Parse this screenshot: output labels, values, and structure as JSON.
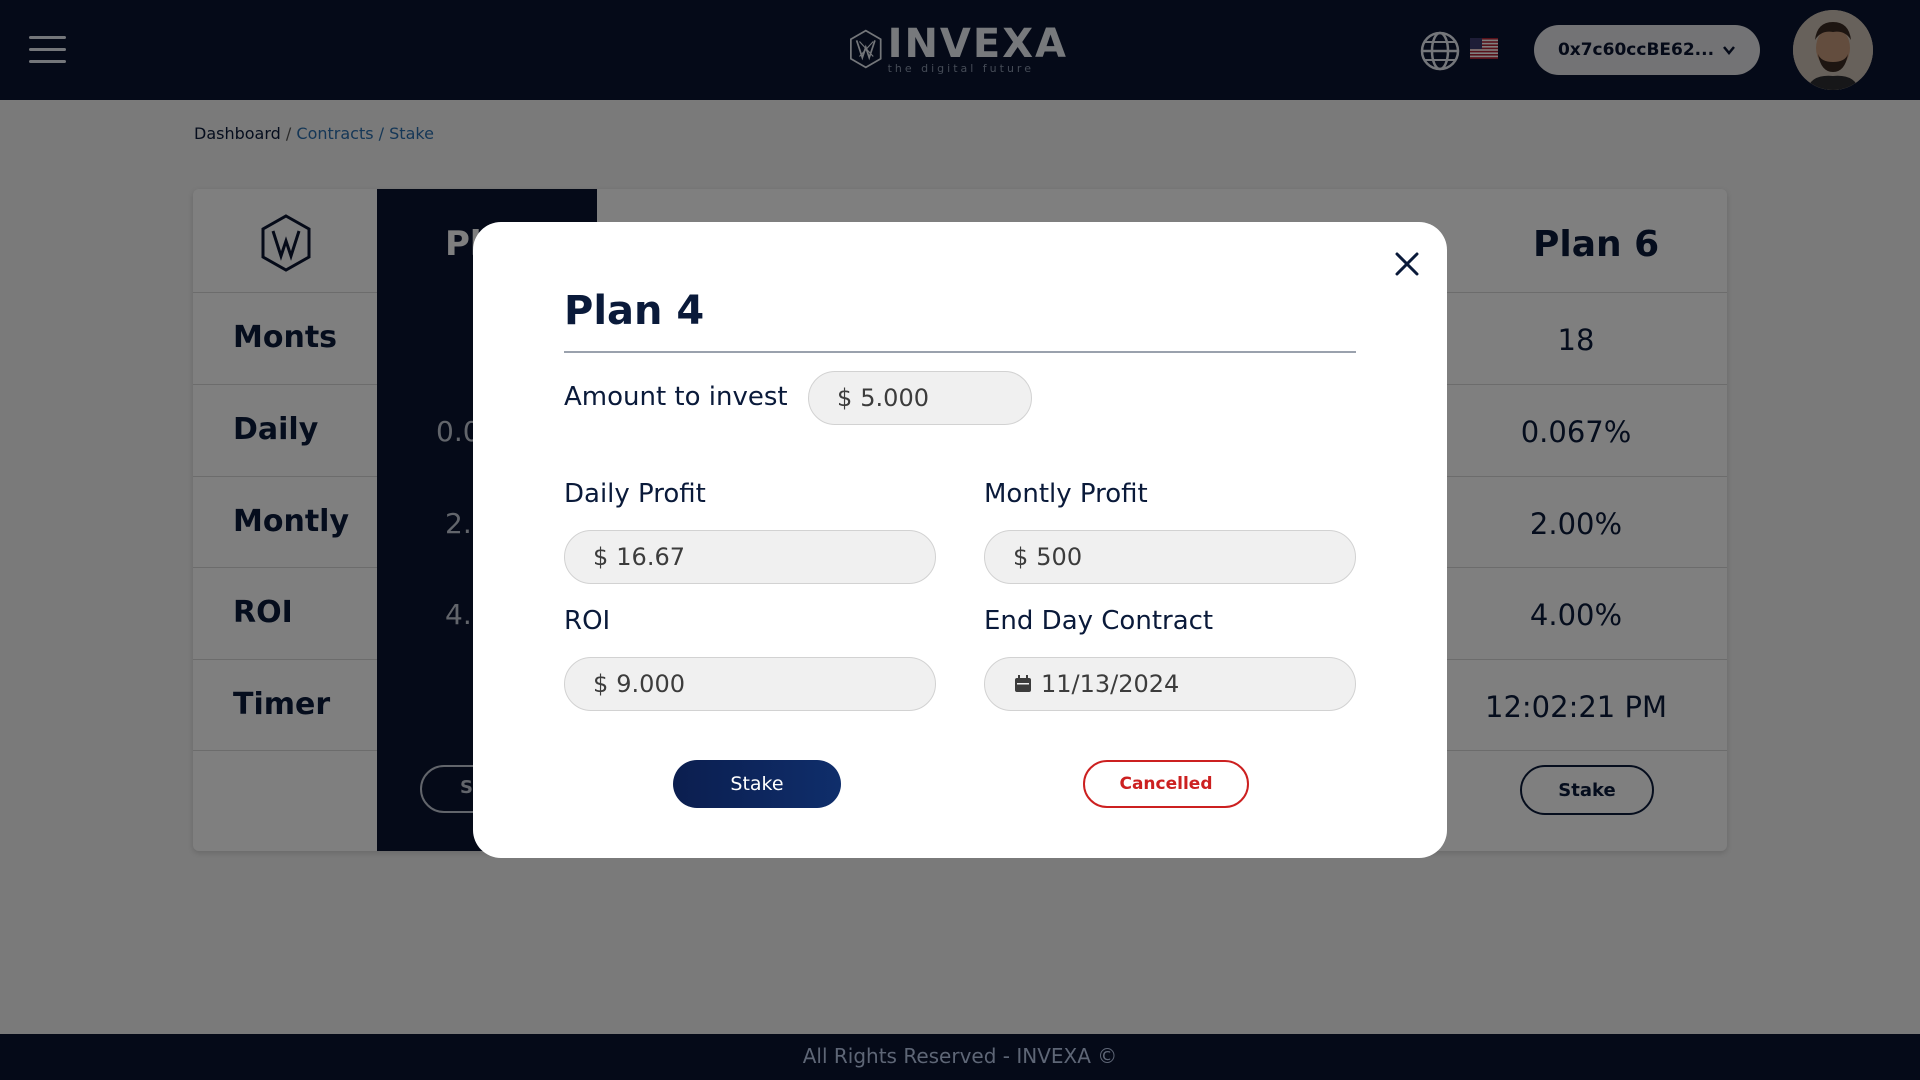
{
  "header": {
    "brand": "INVEXA",
    "tagline": "the digital future",
    "wallet": "0x7c60ccBE62...",
    "icons": {
      "menu": "hamburger-menu-icon",
      "language": "globe-icon",
      "flag": "us-flag-icon",
      "wallet_dropdown": "chevron-down-icon"
    }
  },
  "breadcrumb": {
    "home": "Dashboard",
    "sep": "/",
    "contracts": "Contracts",
    "stake": "Stake"
  },
  "table": {
    "row_labels": [
      "Monts",
      "Daily",
      "Montly",
      "ROI",
      "Timer"
    ],
    "partial_plan": {
      "head": "Pl",
      "daily": "0.0",
      "monthly": "2.",
      "roi": "4.",
      "stake": "S"
    },
    "plan6": {
      "head": "Plan 6",
      "months": "18",
      "daily": "0.067%",
      "monthly": "2.00%",
      "roi": "4.00%",
      "timer": "12:02:21 PM",
      "stake": "Stake"
    }
  },
  "modal": {
    "title": "Plan 4",
    "amount_label": "Amount to invest",
    "currency": "$",
    "amount_value": "5.000",
    "daily_label": "Daily Profit",
    "daily_value": "16.67",
    "monthly_label": "Montly Profit",
    "monthly_value": "500",
    "roi_label": "ROI",
    "roi_value": "9.000",
    "end_label": "End Day Contract",
    "end_value": "11/13/2024",
    "stake_button": "Stake",
    "cancel_button": "Cancelled"
  },
  "footer": {
    "text": "All Rights Reserved - INVEXA ©"
  },
  "colors": {
    "navy": "#0a1530",
    "accent_link": "#2b6fae",
    "cancel_red": "#cc2020"
  }
}
